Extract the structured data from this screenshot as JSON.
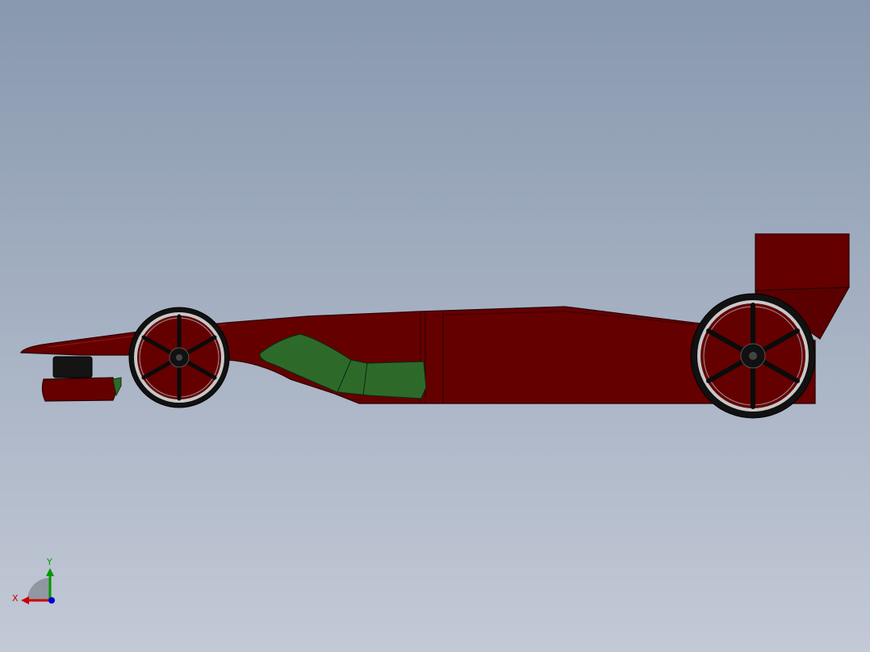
{
  "viewport": {
    "background_top": "#8898ae",
    "background_bottom": "#c3c9d6"
  },
  "model": {
    "body_color": "#650000",
    "sidepod_color": "#2d6a2a",
    "tire_color": "#111111",
    "rim_color": "#c8c8c8"
  },
  "triad": {
    "x_label": "X",
    "y_label": "Y",
    "x_color": "#cc0000",
    "y_color": "#009900",
    "z_color": "#0000cc"
  }
}
